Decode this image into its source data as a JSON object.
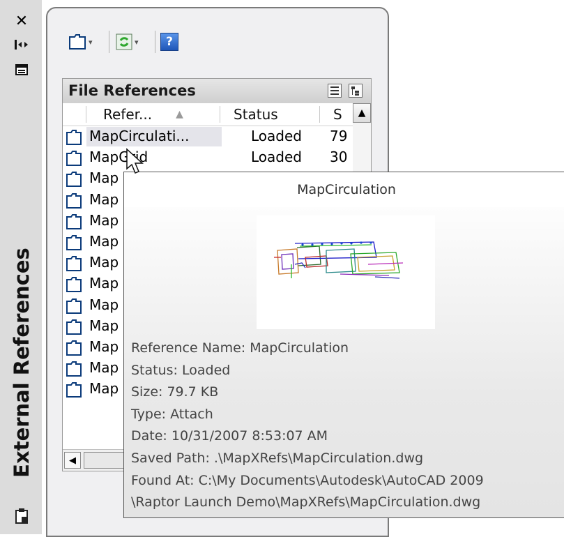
{
  "palette": {
    "strip_bg": "#dcdcdc",
    "panel_bg": "#f0f0f2",
    "selection": "#e4e4ea",
    "icon_stroke": "#0a3a7a",
    "help_blue": "#2f6fd0",
    "refresh_green": "#2ea82e"
  },
  "palette_strip": {
    "title": "External References",
    "close_icon": "✕",
    "autohide_icon": "auto-hide-icon",
    "properties_icon": "properties-icon",
    "bottom_icon": "clipboard-icon"
  },
  "toolbar": {
    "buttons": [
      {
        "name": "attach-dwg-button",
        "icon": "attach-dwg-icon",
        "arrow": "▾"
      },
      {
        "name": "refresh-button",
        "icon": "refresh-icon",
        "arrow": "▾"
      },
      {
        "name": "help-button",
        "icon": "help-icon",
        "glyph": "?"
      }
    ]
  },
  "file_references": {
    "title": "File References",
    "view_buttons": [
      "list-view-icon",
      "tree-view-icon"
    ],
    "columns": [
      {
        "label": "Refer...",
        "sort": "▲"
      },
      {
        "label": "Status"
      },
      {
        "label": "S"
      }
    ],
    "rows": [
      {
        "name": "MapCirculati...",
        "status": "Loaded",
        "size": "79",
        "selected": true
      },
      {
        "name": "MapGrid",
        "status": "Loaded",
        "size": "30"
      },
      {
        "name": "Map"
      },
      {
        "name": "Map"
      },
      {
        "name": "Map"
      },
      {
        "name": "Map"
      },
      {
        "name": "Map"
      },
      {
        "name": "Map"
      },
      {
        "name": "Map"
      },
      {
        "name": "Map"
      },
      {
        "name": "Map"
      },
      {
        "name": "Map"
      },
      {
        "name": "Map"
      }
    ],
    "scroll_up": "▲",
    "scroll_left": "◀"
  },
  "tooltip": {
    "title": "MapCirculation",
    "lines": [
      "Reference Name: MapCirculation",
      "Status: Loaded",
      "Size: 79.7 KB",
      "Type: Attach",
      "Date: 10/31/2007 8:53:07 AM",
      "Saved Path: .\\MapXRefs\\MapCirculation.dwg",
      "Found At: C:\\My Documents\\Autodesk\\AutoCAD 2009",
      "\\Raptor Launch Demo\\MapXRefs\\MapCirculation.dwg"
    ]
  }
}
